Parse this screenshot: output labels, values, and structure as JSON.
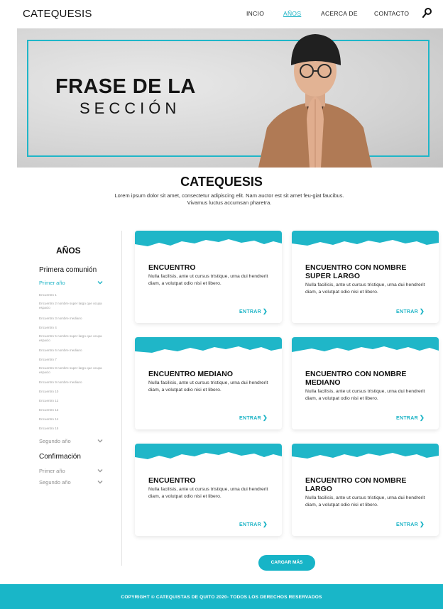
{
  "nav": {
    "logo": "CATEQUESIS",
    "items": [
      "INCIO",
      "AÑOS",
      "ACERCA DE",
      "CONTACTO"
    ],
    "active_index": 1
  },
  "hero": {
    "title": "FRASE DE LA",
    "subtitle": "SECCIÓN"
  },
  "intro": {
    "title": "CATEQUESIS",
    "description": "Lorem ipsum dolor sit amet, consectetur adipiscing elit. Nam auctor est sit amet feu-giat faucibus. Vivamus luctus accumsan pharetra."
  },
  "sidebar": {
    "title": "AÑOS",
    "group1": "Primera comunión",
    "year1": "Primer año",
    "year1_items": [
      "Encuentro 1",
      "Encuentro 2 nombre super largo que ocupa espacio",
      "Encuentro 3 nombre mediano",
      "Encuentro 4",
      "Encuentro 5 nombre super largo que ocupa espacio",
      "Encuentro 6 nombre mediano",
      "Encuentro 7",
      "Encuentro 8 nombre super largo que ocupa espacio",
      "Encuentro 9 nombre mediano",
      "Encuentro 10",
      "Encuentro 12",
      "Encuentro 13",
      "Encuentro 14",
      "Encuentro 15"
    ],
    "year2": "Segundo año",
    "group2": "Confirmación",
    "group2_year1": "Primer año",
    "group2_year2": "Segundo año"
  },
  "cards": [
    {
      "title": "ENCUENTRO",
      "text": "Nulla facilisis, ante ut cursus tristique, urna dui hendrerit diam, a volutpat odio nisi et libero.",
      "link": "ENTRAR"
    },
    {
      "title": "ENCUENTRO CON NOMBRE SUPER LARGO",
      "text": "Nulla facilisis, ante ut cursus tristique, urna dui hendrerit diam, a volutpat odio nisi et libero.",
      "link": "ENTRAR"
    },
    {
      "title": "ENCUENTRO MEDIANO",
      "text": "Nulla facilisis, ante ut cursus tristique, urna dui hendrerit diam, a volutpat odio nisi et libero.",
      "link": "ENTRAR"
    },
    {
      "title": "ENCUENTRO CON NOMBRE MEDIANO",
      "text": "Nulla facilisis, ante ut cursus tristique, urna dui hendrerit diam, a volutpat odio nisi et libero.",
      "link": "ENTRAR"
    },
    {
      "title": "ENCUENTRO",
      "text": "Nulla facilisis, ante ut cursus tristique, urna dui hendrerit diam, a volutpat odio nisi et libero.",
      "link": "ENTRAR"
    },
    {
      "title": "ENCUENTRO CON NOMBRE LARGO",
      "text": "Nulla facilisis, ante ut cursus tristique, urna dui hendrerit diam, a volutpat odio nisi et libero.",
      "link": "ENTRAR"
    }
  ],
  "load_more": "CARGAR MÁS",
  "footer": "COPYRIGHT © CATEQUISTAS DE QUITO 2020- TODOS LOS DERECHOS RESERVADOS",
  "colors": {
    "accent": "#1bb3c5",
    "footer": "#19b6c8",
    "text": "#111111"
  },
  "icons": {
    "search": "search-icon",
    "chevron": "chevron-down-icon",
    "arrow": "chevron-right-icon"
  }
}
